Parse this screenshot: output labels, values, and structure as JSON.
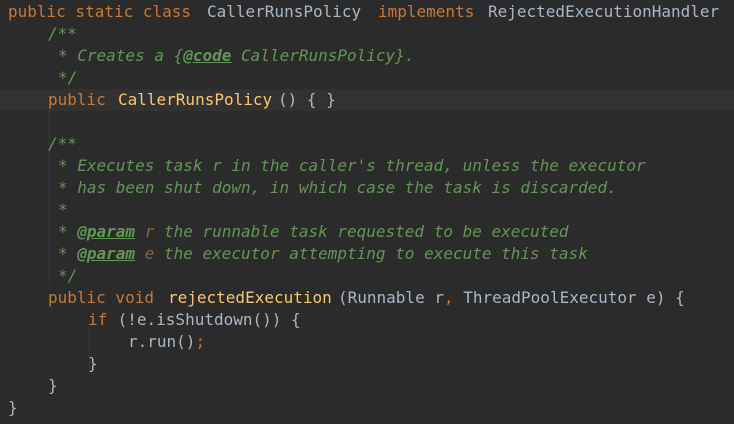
{
  "colors": {
    "background": "#2b2b2b",
    "current_line": "#323232",
    "keyword": "#cc7832",
    "default_text": "#a9b7c6",
    "method_name": "#ffc66d",
    "doc_comment": "#629755",
    "param_value": "#8a653b"
  },
  "code": {
    "l1": {
      "kw": "public static class",
      "name": "CallerRunsPolicy",
      "kw2": "implements",
      "iface": "RejectedExecutionHandler"
    },
    "l2": {
      "text": "/**"
    },
    "l3": {
      "pre": "* Creates a {",
      "tag": "@code",
      "post": " CallerRunsPolicy}."
    },
    "l4": {
      "text": "*/"
    },
    "l5": {
      "kw": "public",
      "fn": "CallerRunsPolicy",
      "rest": "() { }"
    },
    "l7": {
      "text": "/**"
    },
    "l8": {
      "text": "* Executes task r in the caller's thread, unless the executor"
    },
    "l9": {
      "text": "* has been shut down, in which case the task is discarded."
    },
    "l10": {
      "text": "*"
    },
    "l11": {
      "pre": "* ",
      "tag": "@param",
      "pname": "r",
      "post": " the runnable task requested to be executed"
    },
    "l12": {
      "pre": "* ",
      "tag": "@param",
      "pname": "e",
      "post": " the executor attempting to execute this task"
    },
    "l13": {
      "text": "*/"
    },
    "l14": {
      "kw": "public void",
      "fn": "rejectedExecution",
      "open": "(Runnable r",
      "comma": ",",
      "rest": " ThreadPoolExecutor e) {"
    },
    "l15": {
      "kw": "if",
      "rest": " (!e.isShutdown()) {"
    },
    "l16": {
      "call": "r.run()",
      "semi": ";"
    },
    "l17": {
      "text": "}"
    },
    "l18": {
      "text": "}"
    },
    "l19": {
      "text": "}"
    }
  }
}
